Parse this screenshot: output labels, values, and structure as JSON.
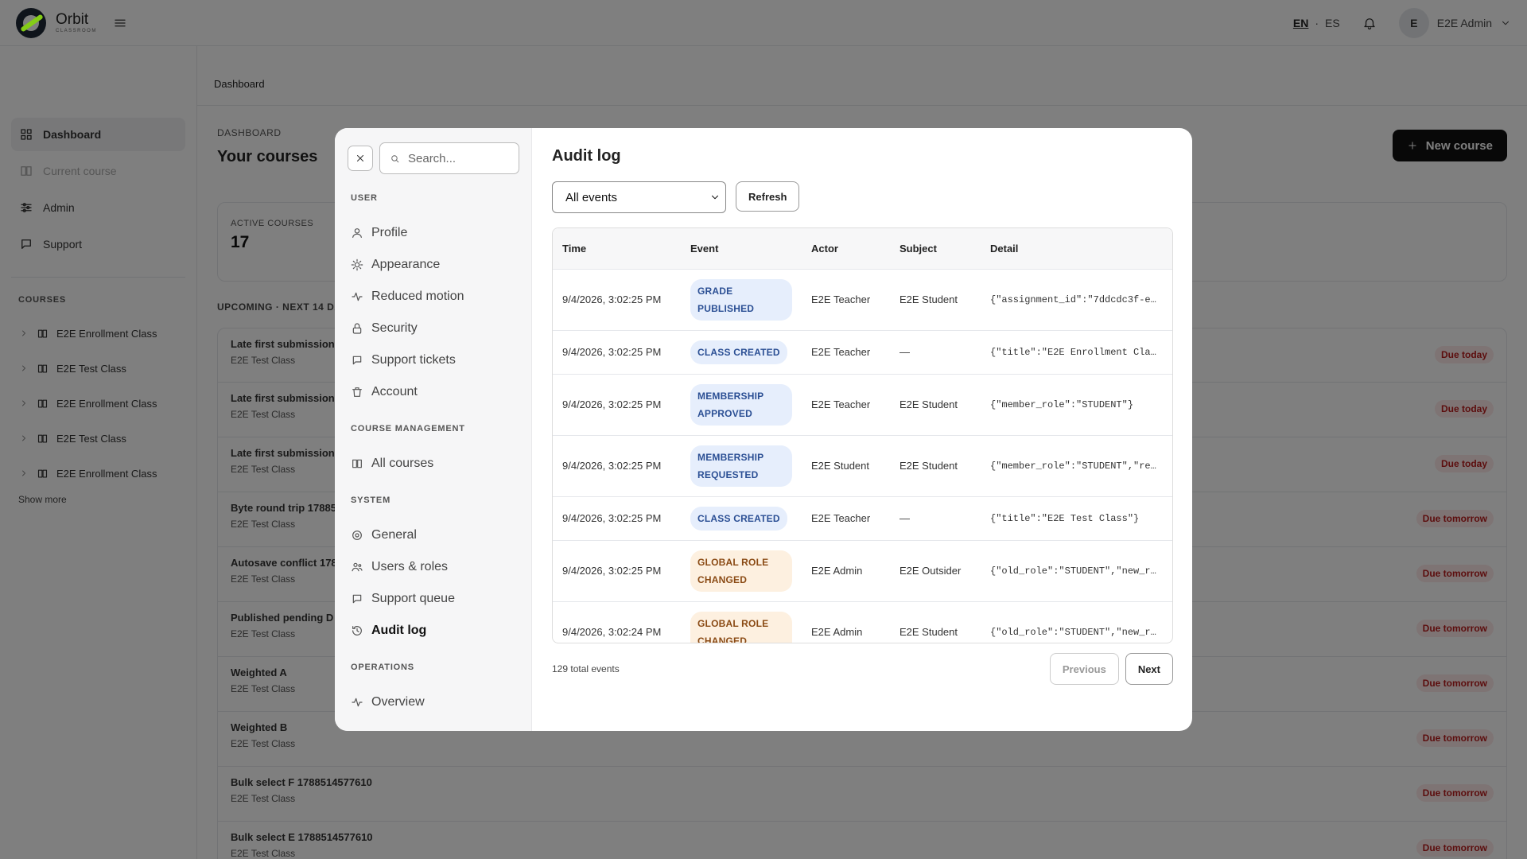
{
  "app": {
    "name": "Orbit",
    "tagline": "CLASSROOM"
  },
  "header": {
    "lang_en": "EN",
    "lang_sep": "·",
    "lang_es": "ES",
    "avatar_initial": "E",
    "user_name": "E2E Admin"
  },
  "sidebar": {
    "nav": [
      {
        "label": "Dashboard",
        "icon": "grid-icon",
        "state": "active"
      },
      {
        "label": "Current course",
        "icon": "book-icon",
        "state": "disabled"
      },
      {
        "label": "Admin",
        "icon": "sliders-icon",
        "state": "normal"
      },
      {
        "label": "Support",
        "icon": "chat-icon",
        "state": "normal"
      }
    ],
    "courses_heading": "COURSES",
    "courses": [
      "E2E Enrollment Class",
      "E2E Test Class",
      "E2E Enrollment Class",
      "E2E Test Class",
      "E2E Enrollment Class"
    ],
    "show_more": "Show more"
  },
  "main": {
    "breadcrumb": "Dashboard",
    "section_label": "DASHBOARD",
    "title": "Your courses",
    "new_course": "New course",
    "stat_label": "ACTIVE COURSES",
    "stat_value": "17",
    "upcoming_heading": "UPCOMING · NEXT 14 DA",
    "upcoming": [
      {
        "title": "Late first submission",
        "course": "E2E Test Class",
        "due": "Due today"
      },
      {
        "title": "Late first submission",
        "course": "E2E Test Class",
        "due": "Due today"
      },
      {
        "title": "Late first submission",
        "course": "E2E Test Class",
        "due": "Due today"
      },
      {
        "title": "Byte round trip 17885",
        "course": "E2E Test Class",
        "due": "Due tomorrow"
      },
      {
        "title": "Autosave conflict 178",
        "course": "E2E Test Class",
        "due": "Due tomorrow"
      },
      {
        "title": "Published pending D",
        "course": "E2E Test Class",
        "due": "Due tomorrow"
      },
      {
        "title": "Weighted A",
        "course": "E2E Test Class",
        "due": "Due tomorrow"
      },
      {
        "title": "Weighted B",
        "course": "E2E Test Class",
        "due": "Due tomorrow"
      },
      {
        "title": "Bulk select F 1788514577610",
        "course": "E2E Test Class",
        "due": "Due tomorrow"
      },
      {
        "title": "Bulk select E 1788514577610",
        "course": "E2E Test Class",
        "due": "Due tomorrow"
      }
    ]
  },
  "modal": {
    "search_placeholder": "Search...",
    "groups": [
      {
        "heading": "USER",
        "items": [
          {
            "label": "Profile",
            "icon": "user-icon"
          },
          {
            "label": "Appearance",
            "icon": "sun-icon"
          },
          {
            "label": "Reduced motion",
            "icon": "pulse-icon"
          },
          {
            "label": "Security",
            "icon": "lock-icon"
          },
          {
            "label": "Support tickets",
            "icon": "chat-icon"
          },
          {
            "label": "Account",
            "icon": "trash-icon"
          }
        ]
      },
      {
        "heading": "COURSE MANAGEMENT",
        "items": [
          {
            "label": "All courses",
            "icon": "book-icon"
          }
        ]
      },
      {
        "heading": "SYSTEM",
        "items": [
          {
            "label": "General",
            "icon": "gear-icon"
          },
          {
            "label": "Users & roles",
            "icon": "users-icon"
          },
          {
            "label": "Support queue",
            "icon": "chat-icon"
          },
          {
            "label": "Audit log",
            "icon": "history-icon",
            "active": true
          }
        ]
      },
      {
        "heading": "OPERATIONS",
        "items": [
          {
            "label": "Overview",
            "icon": "pulse-icon"
          }
        ]
      }
    ],
    "title": "Audit log",
    "filter_value": "All events",
    "refresh": "Refresh",
    "columns": [
      "Time",
      "Event",
      "Actor",
      "Subject",
      "Detail"
    ],
    "rows": [
      {
        "time": "9/4/2026, 3:02:25 PM",
        "event": "GRADE PUBLISHED",
        "tone": "blue",
        "actor": "E2E Teacher",
        "subject": "E2E Student",
        "detail": "{\"assignment_id\":\"7ddcdc3f-e…"
      },
      {
        "time": "9/4/2026, 3:02:25 PM",
        "event": "CLASS CREATED",
        "tone": "blue",
        "actor": "E2E Teacher",
        "subject": "—",
        "detail": "{\"title\":\"E2E Enrollment Cla…"
      },
      {
        "time": "9/4/2026, 3:02:25 PM",
        "event": "MEMBERSHIP APPROVED",
        "tone": "blue",
        "actor": "E2E Teacher",
        "subject": "E2E Student",
        "detail": "{\"member_role\":\"STUDENT\"}"
      },
      {
        "time": "9/4/2026, 3:02:25 PM",
        "event": "MEMBERSHIP REQUESTED",
        "tone": "blue",
        "actor": "E2E Student",
        "subject": "E2E Student",
        "detail": "{\"member_role\":\"STUDENT\",\"re…"
      },
      {
        "time": "9/4/2026, 3:02:25 PM",
        "event": "CLASS CREATED",
        "tone": "blue",
        "actor": "E2E Teacher",
        "subject": "—",
        "detail": "{\"title\":\"E2E Test Class\"}"
      },
      {
        "time": "9/4/2026, 3:02:25 PM",
        "event": "GLOBAL ROLE CHANGED",
        "tone": "orange",
        "actor": "E2E Admin",
        "subject": "E2E Outsider",
        "detail": "{\"old_role\":\"STUDENT\",\"new_r…"
      },
      {
        "time": "9/4/2026, 3:02:24 PM",
        "event": "GLOBAL ROLE CHANGED",
        "tone": "orange",
        "actor": "E2E Admin",
        "subject": "E2E Student",
        "detail": "{\"old_role\":\"STUDENT\",\"new_r…"
      }
    ],
    "total": "129 total events",
    "prev": "Previous",
    "next": "Next"
  }
}
